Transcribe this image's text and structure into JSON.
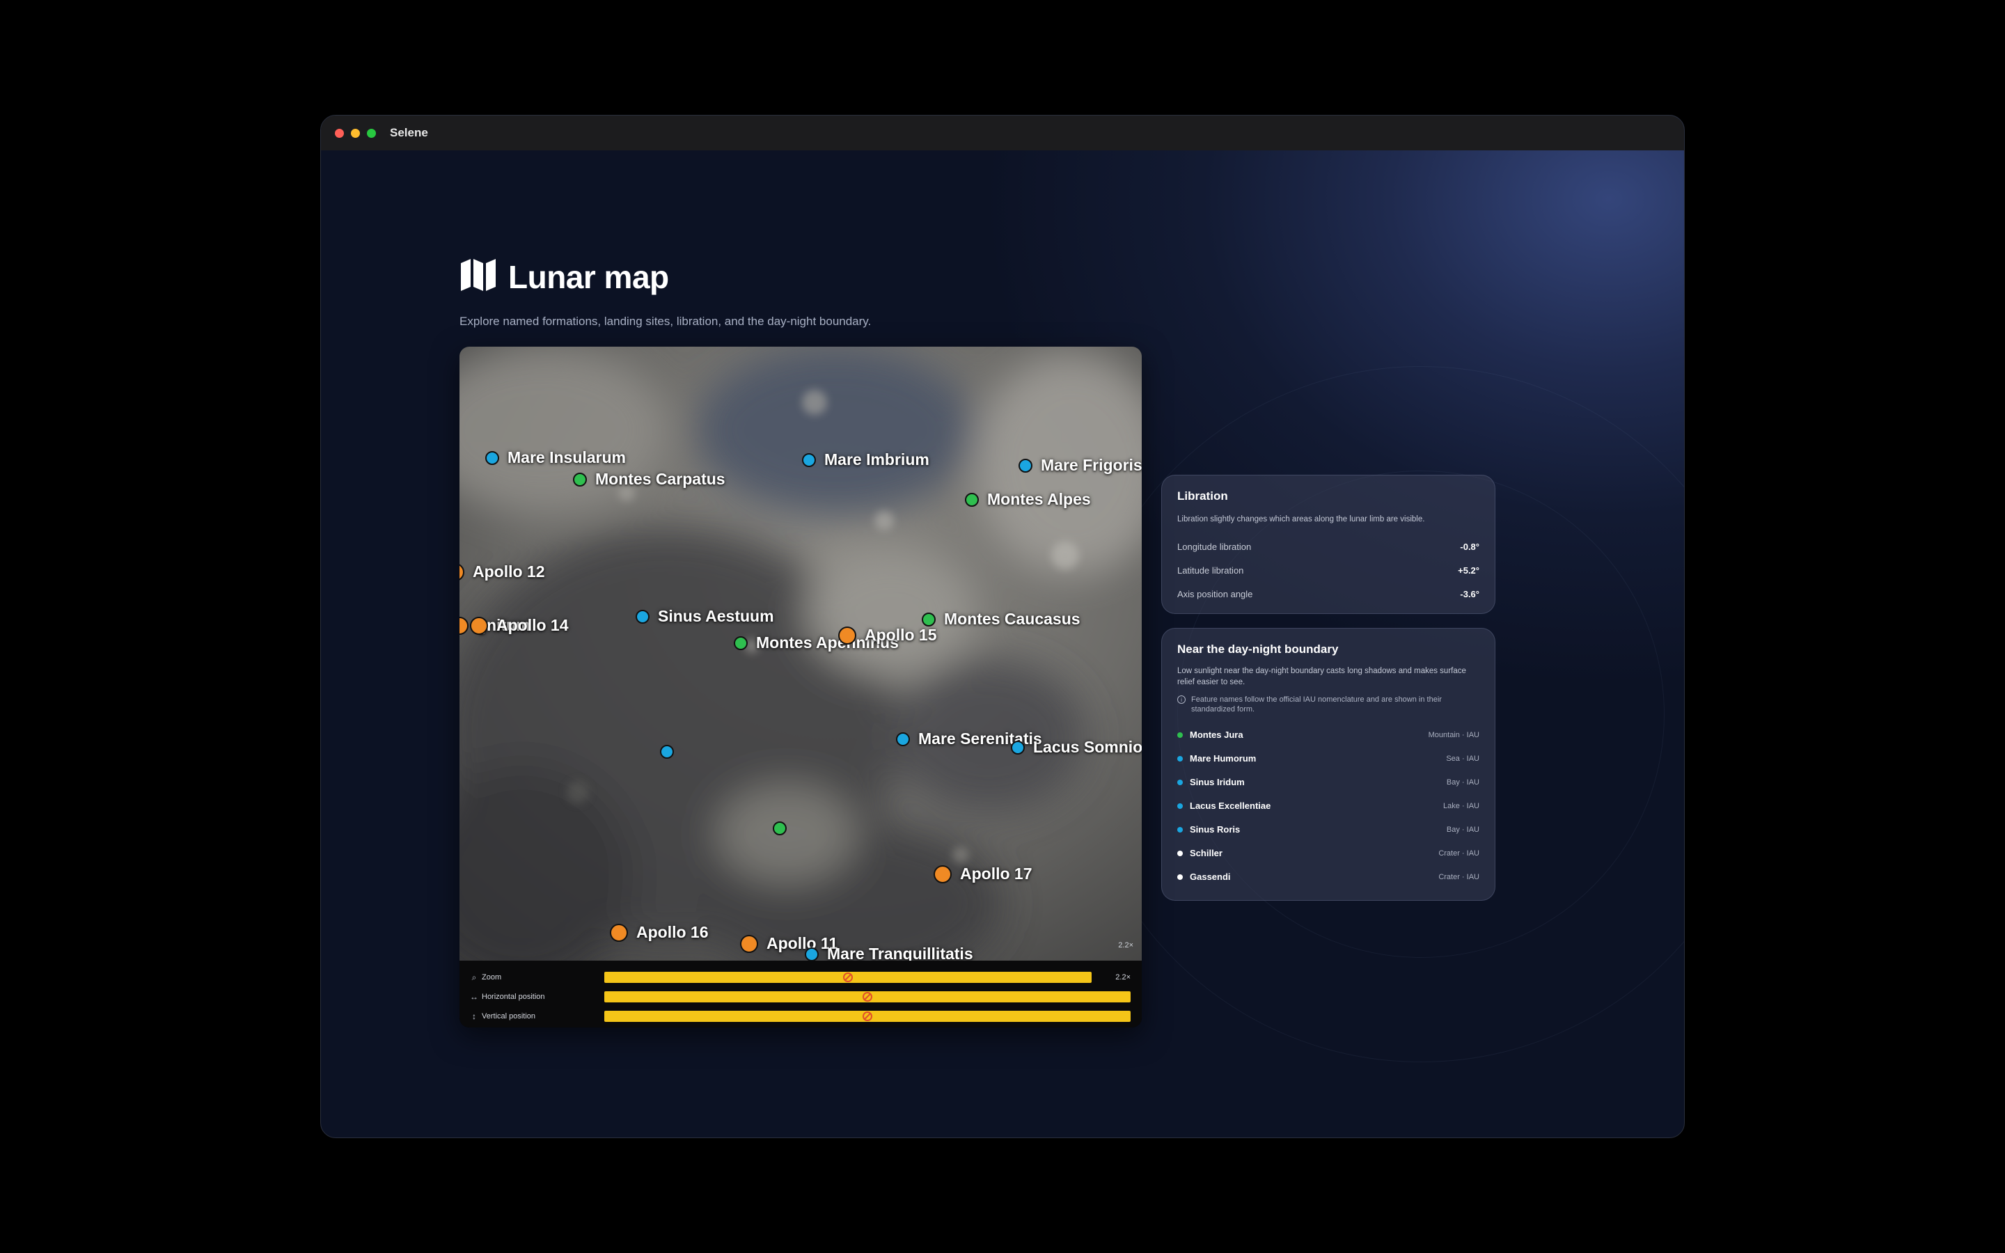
{
  "window": {
    "title": "Selene"
  },
  "header": {
    "title": "Lunar map",
    "subtitle": "Explore named formations, landing sites, libration, and the day-night boundary."
  },
  "colors": {
    "sea": "#1aa6e0",
    "mountain": "#2fbf4f",
    "apollo": "#f08a24",
    "crater": "#ffffff",
    "track": "#f5c518"
  },
  "map": {
    "zoom_badge": "2.2×",
    "markers": [
      {
        "name": "Mare Insularum",
        "kind": "sea"
      },
      {
        "name": "Montes Carpatus",
        "kind": "mountain"
      },
      {
        "name": "Mare Imbrium",
        "kind": "sea"
      },
      {
        "name": "Mare Frigoris",
        "kind": "sea"
      },
      {
        "name": "Montes Alpes",
        "kind": "mountain"
      },
      {
        "name": "Apollo 12",
        "kind": "apollo"
      },
      {
        "name": "gnitum",
        "kind": "apollo"
      },
      {
        "name": "Apollo 14",
        "kind": "apollo"
      },
      {
        "name": "Sinus Aestuum",
        "kind": "sea"
      },
      {
        "name": "Montes Caucasus",
        "kind": "mountain"
      },
      {
        "name": "Montes Apenninus",
        "kind": "mountain"
      },
      {
        "name": "Apollo 15",
        "kind": "apollo"
      },
      {
        "name": "Mare Serenitatis",
        "kind": "sea"
      },
      {
        "name": "Lacus Somnio",
        "kind": "sea"
      },
      {
        "name": "",
        "kind": "sea"
      },
      {
        "name": "",
        "kind": "mountain"
      },
      {
        "name": "Apollo 17",
        "kind": "apollo"
      },
      {
        "name": "Apollo 16",
        "kind": "apollo"
      },
      {
        "name": "Apollo 11",
        "kind": "apollo"
      },
      {
        "name": "Mare Tranquillitatis",
        "kind": "sea"
      }
    ]
  },
  "controls": {
    "zoom": {
      "label": "Zoom",
      "value": "2.2×",
      "level": 0.5
    },
    "horizontal": {
      "label": "Horizontal position",
      "level": 0.5
    },
    "vertical": {
      "label": "Vertical position",
      "level": 0.5
    }
  },
  "libration": {
    "title": "Libration",
    "description": "Libration slightly changes which areas along the lunar limb are visible.",
    "rows": [
      {
        "label": "Longitude libration",
        "value": "-0.8°"
      },
      {
        "label": "Latitude libration",
        "value": "+5.2°"
      },
      {
        "label": "Axis position angle",
        "value": "-3.6°"
      }
    ]
  },
  "boundary": {
    "title": "Near the day-night boundary",
    "description": "Low sunlight near the day-night boundary casts long shadows and makes surface relief easier to see.",
    "note": "Feature names follow the official IAU nomenclature and are shown in their standardized form.",
    "features": [
      {
        "name": "Montes Jura",
        "type": "Mountain · IAU",
        "kind": "mountain"
      },
      {
        "name": "Mare Humorum",
        "type": "Sea · IAU",
        "kind": "sea"
      },
      {
        "name": "Sinus Iridum",
        "type": "Bay · IAU",
        "kind": "sea"
      },
      {
        "name": "Lacus Excellentiae",
        "type": "Lake · IAU",
        "kind": "sea"
      },
      {
        "name": "Sinus Roris",
        "type": "Bay · IAU",
        "kind": "sea"
      },
      {
        "name": "Schiller",
        "type": "Crater · IAU",
        "kind": "crater"
      },
      {
        "name": "Gassendi",
        "type": "Crater · IAU",
        "kind": "crater"
      }
    ]
  }
}
